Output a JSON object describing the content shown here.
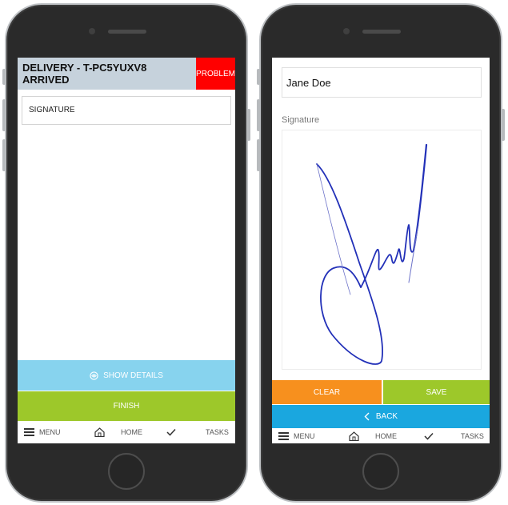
{
  "left": {
    "header_title": "DELIVERY - T-PC5YUXV8\nARRIVED",
    "problem_label": "PROBLEM",
    "signature_field": "SIGNATURE",
    "show_details_label": "SHOW DETAILS",
    "finish_label": "FINISH",
    "tabbar": {
      "menu": "MENU",
      "home": "HOME",
      "tasks": "TASKS"
    }
  },
  "right": {
    "name_value": "Jane Doe",
    "signature_label": "Signature",
    "clear_label": "CLEAR",
    "save_label": "SAVE",
    "back_label": "BACK",
    "tabbar": {
      "menu": "MENU",
      "home": "HOME",
      "tasks": "TASKS"
    }
  },
  "colors": {
    "header_bg": "#c6d2dc",
    "problem": "#ff0000",
    "show_details": "#87d3ee",
    "finish_save": "#9dc82a",
    "clear": "#f7901e",
    "back": "#1aa7df",
    "signature_ink": "#2230b8"
  },
  "icons": {
    "menu": "hamburger-icon",
    "home": "home-icon",
    "tasks": "checkmark-icon",
    "show_details": "eye-icon",
    "back": "chevron-left-icon"
  }
}
